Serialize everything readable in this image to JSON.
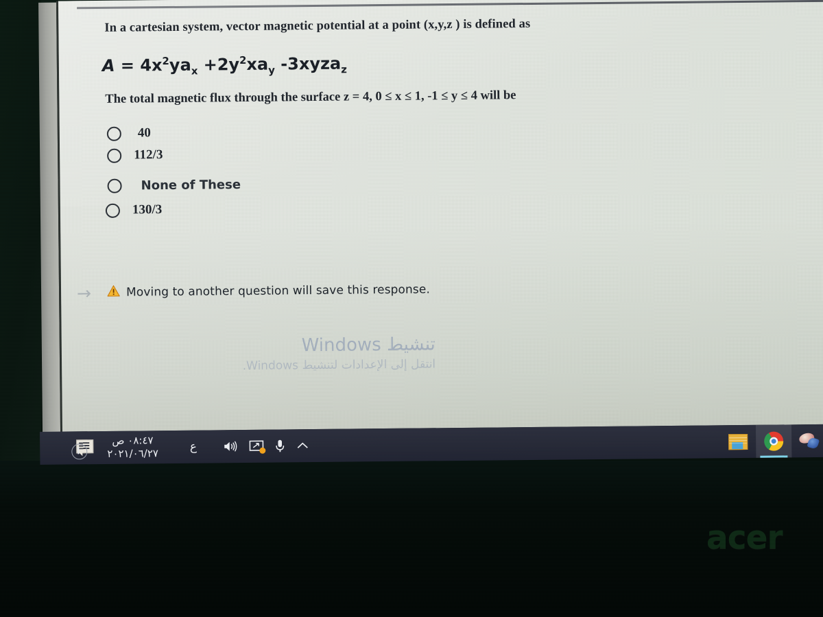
{
  "question": {
    "stem": "In a cartesian system, vector magnetic potential at a point (x,y,z ) is defined as",
    "formula_plain": "A = 4x²ya_x + 2y²xa_y − 3xyza_z",
    "formula_parts": {
      "lhs": "A",
      "equals": "=",
      "t1_coef": "4x",
      "t1_sup": "2",
      "t1_body": "ya",
      "t1_sub": "x",
      "t2_coef": "+2y",
      "t2_sup": "2",
      "t2_body": "xa",
      "t2_sub": "y",
      "t3_coef": "-3xyza",
      "t3_sub": "z"
    },
    "condition": "The total magnetic flux through the surface z = 4, 0 ≤ x ≤ 1, -1 ≤ y ≤ 4 will be",
    "options": [
      {
        "label": "40",
        "style": "serif",
        "selected": false
      },
      {
        "label": "112/3",
        "style": "serif",
        "selected": false
      },
      {
        "label": "None of These",
        "style": "sans",
        "selected": false
      },
      {
        "label": "130/3",
        "style": "serif",
        "selected": false
      }
    ]
  },
  "notice": {
    "arrow_glyph": "→",
    "icon": "warning-triangle-icon",
    "text": "Moving to another question will save this response.",
    "icon_color": "#f0a21c"
  },
  "watermark": {
    "title": "تنشيط Windows",
    "subtitle": "انتقل إلى الإعدادات لتنشيط Windows.",
    "color": "#9aa6b8"
  },
  "taskbar": {
    "notification_icon": "notification-balloon-icon",
    "clock_time": "٠٨:٤٧ ص",
    "clock_date": "٢٠٢١/٠٦/٢٧",
    "language": "ع",
    "tray_icons": [
      "speaker-icon",
      "screen-cast-icon",
      "microphone-icon",
      "chevron-up-icon"
    ],
    "apps": [
      {
        "name": "file-explorer-icon",
        "active": false
      },
      {
        "name": "google-chrome-icon",
        "active": true
      },
      {
        "name": "colorful-app-icon",
        "active": false
      }
    ],
    "background": "#2a2d3b",
    "active_underline": "#7fd3e8"
  },
  "device": {
    "brand": "acer"
  }
}
